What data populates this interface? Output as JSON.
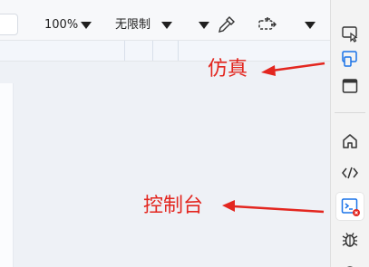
{
  "toolbar": {
    "zoom": "100%",
    "throttle": "无限制",
    "eyedropper_icon": "eyedropper-icon",
    "screenshot_icon": "capture-node-icon"
  },
  "activity_bar": {
    "items": [
      {
        "name": "inspect-icon",
        "label": "inspect"
      },
      {
        "name": "device-emulation-icon",
        "label": "device-emulation"
      },
      {
        "name": "window-icon",
        "label": "window"
      },
      {
        "name": "home-icon",
        "label": "home"
      },
      {
        "name": "code-icon",
        "label": "code"
      },
      {
        "name": "console-icon",
        "label": "console",
        "badge": "error"
      },
      {
        "name": "bug-icon",
        "label": "debug"
      }
    ]
  },
  "annotations": {
    "emulation": "仿真",
    "console": "控制台",
    "color": "#e3261f"
  },
  "colors": {
    "accent_blue": "#1a73e8",
    "error_red": "#e3261f"
  }
}
